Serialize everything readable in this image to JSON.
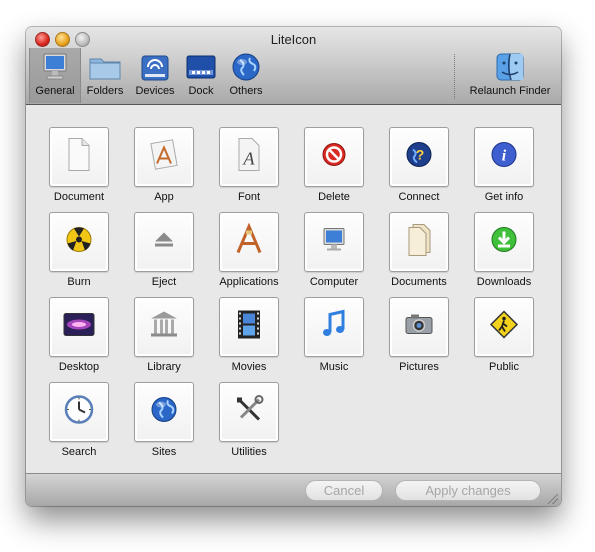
{
  "window": {
    "title": "LiteIcon"
  },
  "toolbar": {
    "items": [
      {
        "label": "General",
        "icon": "monitor-icon",
        "selected": true
      },
      {
        "label": "Folders",
        "icon": "folder-icon",
        "selected": false
      },
      {
        "label": "Devices",
        "icon": "drive-icon",
        "selected": false
      },
      {
        "label": "Dock",
        "icon": "dock-icon",
        "selected": false
      },
      {
        "label": "Others",
        "icon": "globe-icon",
        "selected": false
      }
    ],
    "relaunch": {
      "label": "Relaunch Finder",
      "icon": "finder-icon"
    }
  },
  "grid": {
    "items": [
      {
        "label": "Document",
        "icon": "document-icon"
      },
      {
        "label": "App",
        "icon": "app-icon"
      },
      {
        "label": "Font",
        "icon": "font-icon"
      },
      {
        "label": "Delete",
        "icon": "delete-icon"
      },
      {
        "label": "Connect",
        "icon": "connect-icon"
      },
      {
        "label": "Get info",
        "icon": "info-icon"
      },
      {
        "label": "Burn",
        "icon": "burn-icon"
      },
      {
        "label": "Eject",
        "icon": "eject-icon"
      },
      {
        "label": "Applications",
        "icon": "applications-icon"
      },
      {
        "label": "Computer",
        "icon": "computer-icon"
      },
      {
        "label": "Documents",
        "icon": "documents-icon"
      },
      {
        "label": "Downloads",
        "icon": "downloads-icon"
      },
      {
        "label": "Desktop",
        "icon": "desktop-icon"
      },
      {
        "label": "Library",
        "icon": "library-icon"
      },
      {
        "label": "Movies",
        "icon": "movies-icon"
      },
      {
        "label": "Music",
        "icon": "music-icon"
      },
      {
        "label": "Pictures",
        "icon": "pictures-icon"
      },
      {
        "label": "Public",
        "icon": "public-icon"
      },
      {
        "label": "Search",
        "icon": "search-icon"
      },
      {
        "label": "Sites",
        "icon": "sites-icon"
      },
      {
        "label": "Utilities",
        "icon": "utilities-icon"
      }
    ]
  },
  "footer": {
    "cancel_label": "Cancel",
    "apply_label": "Apply changes",
    "buttons_enabled": false
  }
}
